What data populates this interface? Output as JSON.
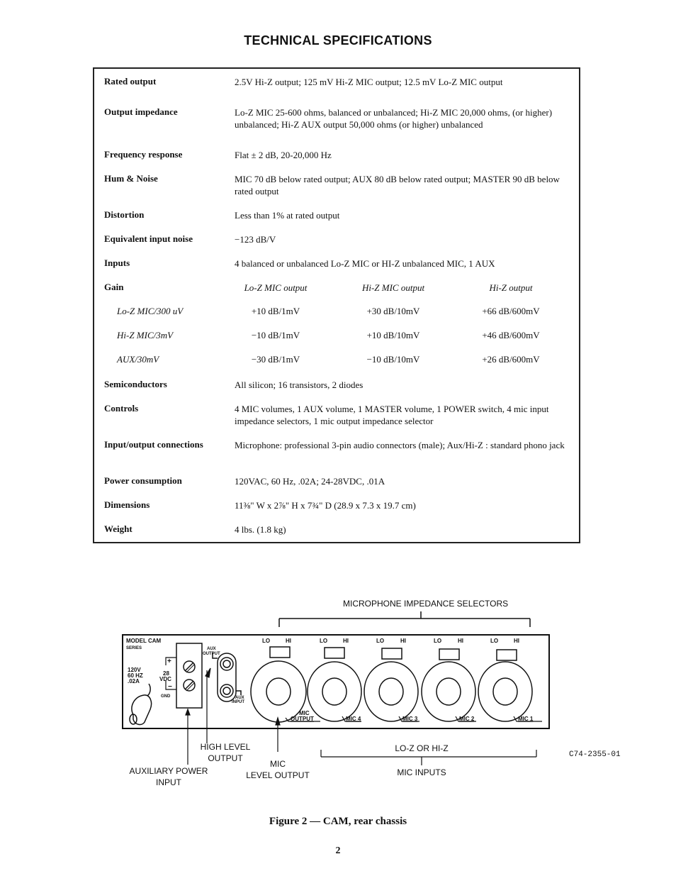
{
  "page": {
    "title": "TECHNICAL SPECIFICATIONS",
    "page_number": "2"
  },
  "specs": [
    {
      "label": "Rated output",
      "value": "2.5V Hi-Z output;  125 mV Hi-Z MIC output;  12.5 mV Lo-Z MIC output"
    },
    {
      "label": "Output impedance",
      "value": "Lo-Z MIC 25-600 ohms, balanced or unbalanced; Hi-Z MIC 20,000 ohms, (or higher) unbalanced; Hi-Z AUX output 50,000 ohms (or higher) unbalanced"
    },
    {
      "label": "Frequency response",
      "value": "Flat ± 2 dB, 20-20,000 Hz"
    },
    {
      "label": "Hum & Noise",
      "value": "MIC 70 dB below rated output; AUX 80 dB below rated output; MASTER 90 dB below rated output"
    },
    {
      "label": "Distortion",
      "value": "Less than 1% at rated output"
    },
    {
      "label": "Equivalent input noise",
      "value": "−123 dB/V"
    },
    {
      "label": "Inputs",
      "value": "4 balanced or unbalanced Lo-Z MIC or HI-Z unbalanced MIC, 1 AUX"
    },
    {
      "label": "Gain",
      "value": ""
    },
    {
      "label": "Semiconductors",
      "value": "All silicon; 16 transistors, 2 diodes"
    },
    {
      "label": "Controls",
      "value": "4 MIC volumes, 1 AUX volume, 1 MASTER volume, 1 POWER switch, 4 mic input impedance selectors, 1 mic output impedance selector"
    },
    {
      "label": "Input/output connections",
      "value": "Microphone:  professional 3-pin audio connectors (male); Aux/Hi-Z :   standard phono jack"
    },
    {
      "label": "Power consumption",
      "value": "120VAC, 60 Hz, .02A;  24-28VDC, .01A"
    },
    {
      "label": "Dimensions",
      "value": "11⅜\" W x 2⅞\" H x 7¾\" D (28.9 x 7.3 x 19.7 cm)"
    },
    {
      "label": "Weight",
      "value": "4 lbs. (1.8 kg)"
    }
  ],
  "gain_table": {
    "headers": [
      "Lo-Z MIC output",
      "Hi-Z MIC output",
      "Hi-Z output"
    ],
    "rows": [
      {
        "label": "Lo-Z MIC/300 uV",
        "cells": [
          "+10 dB/1mV",
          "+30 dB/10mV",
          "+66 dB/600mV"
        ]
      },
      {
        "label": "Hi-Z MIC/3mV",
        "cells": [
          "−10 dB/1mV",
          "+10 dB/10mV",
          "+46 dB/600mV"
        ]
      },
      {
        "label": "AUX/30mV",
        "cells": [
          "−30 dB/1mV",
          "−10 dB/10mV",
          "+26 dB/600mV"
        ]
      }
    ]
  },
  "figure": {
    "caption": "Figure 2 — CAM, rear chassis",
    "code": "C74-2355-01",
    "chassis": {
      "model": "MODEL CAM",
      "series": "SERIES",
      "power_rating": [
        "120V",
        "60 HZ",
        ".02A"
      ],
      "dc_label": [
        "28",
        "VDC"
      ],
      "plus": "+",
      "minus": "−",
      "gnd": "GND",
      "aux_output": [
        "AUX",
        "OUTPUT"
      ],
      "aux_input": [
        "AUX",
        "INPUT"
      ],
      "selector_lo": "LO",
      "selector_hi": "HI",
      "connectors": [
        "MIC OUTPUT",
        "MIC 4",
        "MIC 3",
        "MIC 2",
        "MIC 1"
      ],
      "mic_output_top": "MIC",
      "mic_output_bottom": "OUTPUT"
    },
    "callouts": {
      "impedance_selectors": "MICROPHONE IMPEDANCE SELECTORS",
      "high_level_output": [
        "HIGH LEVEL",
        "OUTPUT"
      ],
      "aux_power_input": [
        "AUXILIARY POWER",
        "INPUT"
      ],
      "mic_level_output": [
        "MIC",
        "LEVEL OUTPUT"
      ],
      "lo_hi_z": "LO-Z OR HI-Z",
      "mic_inputs": "MIC INPUTS"
    }
  }
}
